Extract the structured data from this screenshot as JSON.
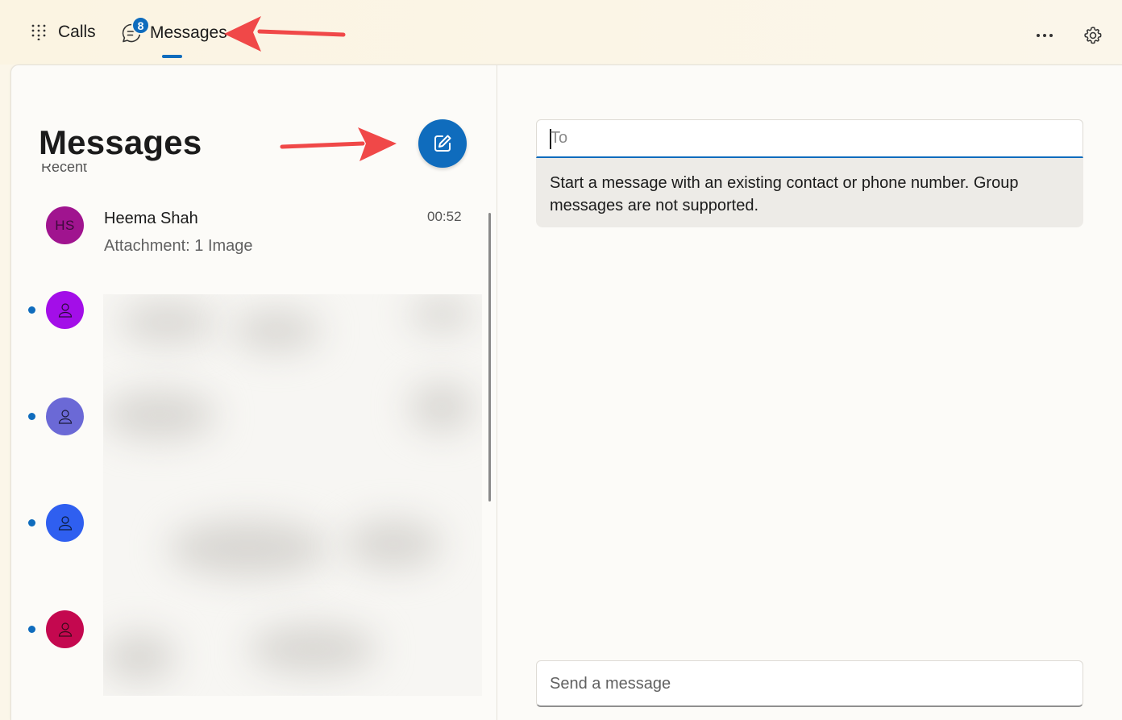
{
  "nav": {
    "calls_label": "Calls",
    "messages_label": "Messages",
    "messages_badge": "8",
    "more_icon": "more-horizontal-icon",
    "settings_icon": "gear-icon"
  },
  "left_pane": {
    "title": "Messages",
    "section_label": "Recent",
    "new_message_icon": "compose-icon",
    "conversations": [
      {
        "initials": "HS",
        "name": "Heema Shah",
        "preview": "Attachment: 1 Image",
        "time": "00:52",
        "avatar_color": "#a0148f",
        "unread": false
      },
      {
        "initials": "",
        "name": "",
        "preview": "",
        "time": "",
        "avatar_color": "#a30ee8",
        "unread": true
      },
      {
        "initials": "",
        "name": "",
        "preview": "",
        "time": "",
        "avatar_color": "#6b69d6",
        "unread": true
      },
      {
        "initials": "",
        "name": "",
        "preview": "",
        "time": "",
        "avatar_color": "#2f5ff0",
        "unread": true
      },
      {
        "initials": "",
        "name": "",
        "preview": "",
        "time": "",
        "avatar_color": "#c4084f",
        "unread": true
      }
    ]
  },
  "compose": {
    "to_placeholder": "To",
    "hint": "Start a message with an existing contact or phone number. Group messages are not supported.",
    "send_placeholder": "Send a message"
  },
  "colors": {
    "accent": "#0f6cbd",
    "annotation_arrow": "#f04848"
  }
}
